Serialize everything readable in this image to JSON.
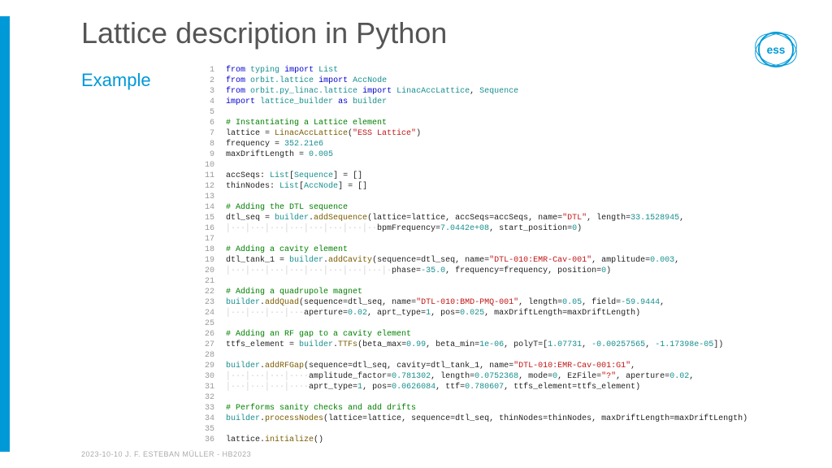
{
  "title": "Lattice description in Python",
  "subtitle": "Example",
  "footer": "2023-10-10    J. F. ESTEBAN MÜLLER - HB2023",
  "logo_text": "ess",
  "code": [
    [
      {
        "c": "kw",
        "t": "from"
      },
      {
        "c": "plain",
        "t": " "
      },
      {
        "c": "mod",
        "t": "typing"
      },
      {
        "c": "plain",
        "t": " "
      },
      {
        "c": "kw",
        "t": "import"
      },
      {
        "c": "plain",
        "t": " "
      },
      {
        "c": "mod",
        "t": "List"
      }
    ],
    [
      {
        "c": "kw",
        "t": "from"
      },
      {
        "c": "plain",
        "t": " "
      },
      {
        "c": "mod",
        "t": "orbit.lattice"
      },
      {
        "c": "plain",
        "t": " "
      },
      {
        "c": "kw",
        "t": "import"
      },
      {
        "c": "plain",
        "t": " "
      },
      {
        "c": "mod",
        "t": "AccNode"
      }
    ],
    [
      {
        "c": "kw",
        "t": "from"
      },
      {
        "c": "plain",
        "t": " "
      },
      {
        "c": "mod",
        "t": "orbit.py_linac.lattice"
      },
      {
        "c": "plain",
        "t": " "
      },
      {
        "c": "kw",
        "t": "import"
      },
      {
        "c": "plain",
        "t": " "
      },
      {
        "c": "mod",
        "t": "LinacAccLattice"
      },
      {
        "c": "plain",
        "t": ", "
      },
      {
        "c": "mod",
        "t": "Sequence"
      }
    ],
    [
      {
        "c": "kw",
        "t": "import"
      },
      {
        "c": "plain",
        "t": " "
      },
      {
        "c": "mod",
        "t": "lattice_builder"
      },
      {
        "c": "plain",
        "t": " "
      },
      {
        "c": "kw",
        "t": "as"
      },
      {
        "c": "plain",
        "t": " "
      },
      {
        "c": "mod",
        "t": "builder"
      }
    ],
    [],
    [
      {
        "c": "cmt",
        "t": "# Instantiating a Lattice element"
      }
    ],
    [
      {
        "c": "plain",
        "t": "lattice = "
      },
      {
        "c": "fn",
        "t": "LinacAccLattice"
      },
      {
        "c": "plain",
        "t": "("
      },
      {
        "c": "str",
        "t": "\"ESS Lattice\""
      },
      {
        "c": "plain",
        "t": ")"
      }
    ],
    [
      {
        "c": "plain",
        "t": "frequency = "
      },
      {
        "c": "num",
        "t": "352.21e6"
      }
    ],
    [
      {
        "c": "plain",
        "t": "maxDriftLength = "
      },
      {
        "c": "num",
        "t": "0.005"
      }
    ],
    [],
    [
      {
        "c": "plain",
        "t": "accSeqs: "
      },
      {
        "c": "mod",
        "t": "List"
      },
      {
        "c": "plain",
        "t": "["
      },
      {
        "c": "mod",
        "t": "Sequence"
      },
      {
        "c": "plain",
        "t": "] = []"
      }
    ],
    [
      {
        "c": "plain",
        "t": "thinNodes: "
      },
      {
        "c": "mod",
        "t": "List"
      },
      {
        "c": "plain",
        "t": "["
      },
      {
        "c": "mod",
        "t": "AccNode"
      },
      {
        "c": "plain",
        "t": "] = []"
      }
    ],
    [],
    [
      {
        "c": "cmt",
        "t": "# Adding the DTL sequence"
      }
    ],
    [
      {
        "c": "plain",
        "t": "dtl_seq = "
      },
      {
        "c": "mod",
        "t": "builder"
      },
      {
        "c": "plain",
        "t": "."
      },
      {
        "c": "fn",
        "t": "addSequence"
      },
      {
        "c": "plain",
        "t": "(lattice=lattice, accSeqs=accSeqs, name="
      },
      {
        "c": "str",
        "t": "\"DTL\""
      },
      {
        "c": "plain",
        "t": ", length="
      },
      {
        "c": "num",
        "t": "33.1528945"
      },
      {
        "c": "plain",
        "t": ","
      }
    ],
    [
      {
        "c": "guide",
        "t": "│···│···│···│···│···│···│···│··"
      },
      {
        "c": "plain",
        "t": "bpmFrequency="
      },
      {
        "c": "num",
        "t": "7.0442e+08"
      },
      {
        "c": "plain",
        "t": ", start_position="
      },
      {
        "c": "num",
        "t": "0"
      },
      {
        "c": "plain",
        "t": ")"
      }
    ],
    [],
    [
      {
        "c": "cmt",
        "t": "# Adding a cavity element"
      }
    ],
    [
      {
        "c": "plain",
        "t": "dtl_tank_1 = "
      },
      {
        "c": "mod",
        "t": "builder"
      },
      {
        "c": "plain",
        "t": "."
      },
      {
        "c": "fn",
        "t": "addCavity"
      },
      {
        "c": "plain",
        "t": "(sequence=dtl_seq, name="
      },
      {
        "c": "str",
        "t": "\"DTL-010:EMR-Cav-001\""
      },
      {
        "c": "plain",
        "t": ", amplitude="
      },
      {
        "c": "num",
        "t": "0.003"
      },
      {
        "c": "plain",
        "t": ","
      }
    ],
    [
      {
        "c": "guide",
        "t": "│···│···│···│···│···│···│···│···│·"
      },
      {
        "c": "plain",
        "t": "phase="
      },
      {
        "c": "num",
        "t": "-35.0"
      },
      {
        "c": "plain",
        "t": ", frequency=frequency, position="
      },
      {
        "c": "num",
        "t": "0"
      },
      {
        "c": "plain",
        "t": ")"
      }
    ],
    [],
    [
      {
        "c": "cmt",
        "t": "# Adding a quadrupole magnet"
      }
    ],
    [
      {
        "c": "mod",
        "t": "builder"
      },
      {
        "c": "plain",
        "t": "."
      },
      {
        "c": "fn",
        "t": "addQuad"
      },
      {
        "c": "plain",
        "t": "(sequence=dtl_seq, name="
      },
      {
        "c": "str",
        "t": "\"DTL-010:BMD-PMQ-001\""
      },
      {
        "c": "plain",
        "t": ", length="
      },
      {
        "c": "num",
        "t": "0.05"
      },
      {
        "c": "plain",
        "t": ", field="
      },
      {
        "c": "num",
        "t": "-59.9444"
      },
      {
        "c": "plain",
        "t": ","
      }
    ],
    [
      {
        "c": "guide",
        "t": "│···│···│···│···"
      },
      {
        "c": "plain",
        "t": "aperture="
      },
      {
        "c": "num",
        "t": "0.02"
      },
      {
        "c": "plain",
        "t": ", aprt_type="
      },
      {
        "c": "num",
        "t": "1"
      },
      {
        "c": "plain",
        "t": ", pos="
      },
      {
        "c": "num",
        "t": "0.025"
      },
      {
        "c": "plain",
        "t": ", maxDriftLength=maxDriftLength)"
      }
    ],
    [],
    [
      {
        "c": "cmt",
        "t": "# Adding an RF gap to a cavity element"
      }
    ],
    [
      {
        "c": "plain",
        "t": "ttfs_element = "
      },
      {
        "c": "mod",
        "t": "builder"
      },
      {
        "c": "plain",
        "t": "."
      },
      {
        "c": "fn",
        "t": "TTFs"
      },
      {
        "c": "plain",
        "t": "(beta_max="
      },
      {
        "c": "num",
        "t": "0.99"
      },
      {
        "c": "plain",
        "t": ", beta_min="
      },
      {
        "c": "num",
        "t": "1e-06"
      },
      {
        "c": "plain",
        "t": ", polyT=["
      },
      {
        "c": "num",
        "t": "1.07731"
      },
      {
        "c": "plain",
        "t": ", "
      },
      {
        "c": "num",
        "t": "-0.00257565"
      },
      {
        "c": "plain",
        "t": ", "
      },
      {
        "c": "num",
        "t": "-1.17398e-05"
      },
      {
        "c": "plain",
        "t": "])"
      }
    ],
    [],
    [
      {
        "c": "mod",
        "t": "builder"
      },
      {
        "c": "plain",
        "t": "."
      },
      {
        "c": "fn",
        "t": "addRFGap"
      },
      {
        "c": "plain",
        "t": "(sequence=dtl_seq, cavity=dtl_tank_1, name="
      },
      {
        "c": "str",
        "t": "\"DTL-010:EMR-Cav-001:G1\""
      },
      {
        "c": "plain",
        "t": ","
      }
    ],
    [
      {
        "c": "guide",
        "t": "│···│···│···│····"
      },
      {
        "c": "plain",
        "t": "amplitude_factor="
      },
      {
        "c": "num",
        "t": "0.781302"
      },
      {
        "c": "plain",
        "t": ", length="
      },
      {
        "c": "num",
        "t": "0.0752368"
      },
      {
        "c": "plain",
        "t": ", mode="
      },
      {
        "c": "num",
        "t": "0"
      },
      {
        "c": "plain",
        "t": ", EzFile="
      },
      {
        "c": "str",
        "t": "\"?\""
      },
      {
        "c": "plain",
        "t": ", aperture="
      },
      {
        "c": "num",
        "t": "0.02"
      },
      {
        "c": "plain",
        "t": ","
      }
    ],
    [
      {
        "c": "guide",
        "t": "│···│···│···│····"
      },
      {
        "c": "plain",
        "t": "aprt_type="
      },
      {
        "c": "num",
        "t": "1"
      },
      {
        "c": "plain",
        "t": ", pos="
      },
      {
        "c": "num",
        "t": "0.0626084"
      },
      {
        "c": "plain",
        "t": ", ttf="
      },
      {
        "c": "num",
        "t": "0.780607"
      },
      {
        "c": "plain",
        "t": ", ttfs_element=ttfs_element)"
      }
    ],
    [],
    [
      {
        "c": "cmt",
        "t": "# Performs sanity checks and add drifts"
      }
    ],
    [
      {
        "c": "mod",
        "t": "builder"
      },
      {
        "c": "plain",
        "t": "."
      },
      {
        "c": "fn",
        "t": "processNodes"
      },
      {
        "c": "plain",
        "t": "(lattice=lattice, sequence=dtl_seq, thinNodes=thinNodes, maxDriftLength=maxDriftLength)"
      }
    ],
    [],
    [
      {
        "c": "plain",
        "t": "lattice."
      },
      {
        "c": "fn",
        "t": "initialize"
      },
      {
        "c": "plain",
        "t": "()"
      }
    ]
  ]
}
